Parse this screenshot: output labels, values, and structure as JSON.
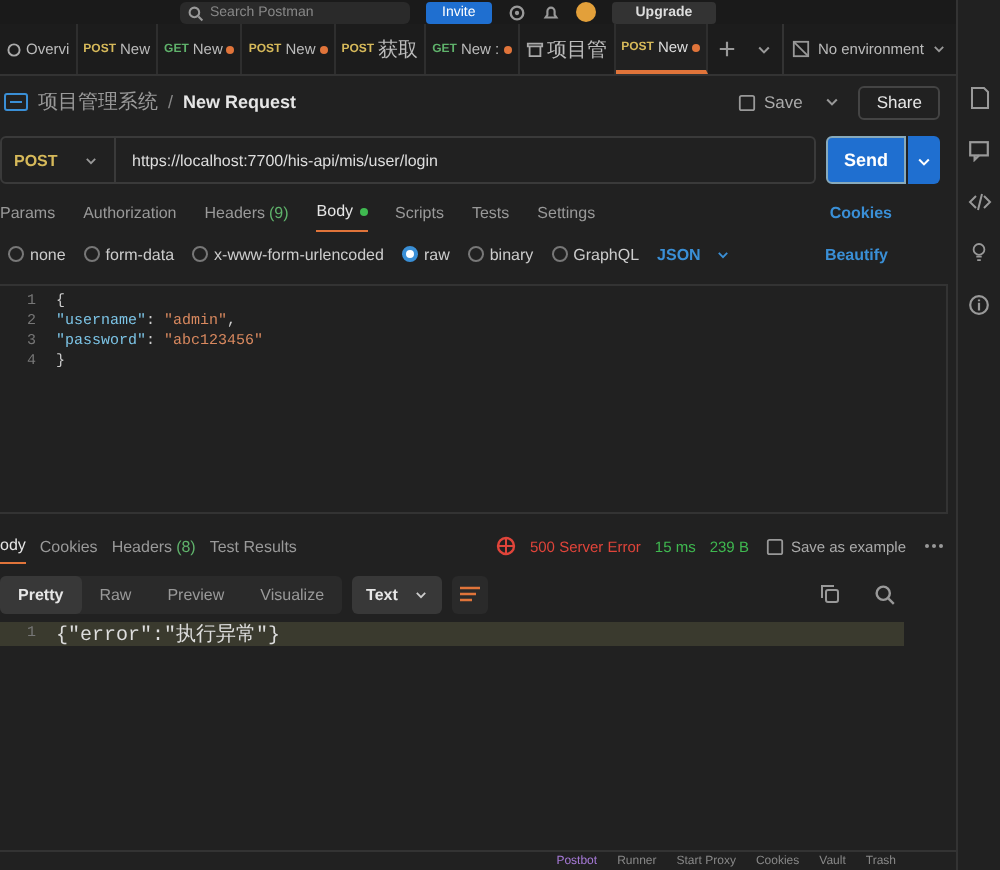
{
  "top_bar": {
    "search": {
      "placeholder": "Search Postman"
    },
    "invite": "Invite",
    "upgrade": "Upgrade"
  },
  "tabs": [
    {
      "kind": "overview",
      "label": "Overvi",
      "unsaved": false,
      "selected": false
    },
    {
      "kind": "request",
      "method": "POST",
      "label": "New",
      "unsaved": false,
      "selected": false
    },
    {
      "kind": "request",
      "method": "GET",
      "label": "New",
      "unsaved": true,
      "selected": false
    },
    {
      "kind": "request",
      "method": "POST",
      "label": "New",
      "unsaved": true,
      "selected": false
    },
    {
      "kind": "request",
      "method": "POST",
      "label": "获取",
      "unsaved": false,
      "selected": false
    },
    {
      "kind": "request",
      "method": "GET",
      "label": "New :",
      "unsaved": true,
      "selected": false
    },
    {
      "kind": "collection",
      "label": "项目管",
      "unsaved": false,
      "selected": false
    },
    {
      "kind": "request",
      "method": "POST",
      "label": "New",
      "unsaved": true,
      "selected": true
    }
  ],
  "environment": "No environment",
  "breadcrumb": {
    "collection": "项目管理系统",
    "separator": "/",
    "request": "New Request"
  },
  "save": "Save",
  "share": "Share",
  "request": {
    "method": "POST",
    "url": "https://localhost:7700/his-api/mis/user/login",
    "send": "Send"
  },
  "request_tabs": [
    {
      "label": "Params",
      "dot": false,
      "selected": false
    },
    {
      "label": "Authorization",
      "dot": false,
      "selected": false
    },
    {
      "label": "Headers",
      "count": "(9)",
      "dot": false,
      "selected": false
    },
    {
      "label": "Body",
      "dot": true,
      "selected": true
    },
    {
      "label": "Scripts",
      "dot": false,
      "selected": false
    },
    {
      "label": "Tests",
      "dot": false,
      "selected": false
    },
    {
      "label": "Settings",
      "dot": false,
      "selected": false
    }
  ],
  "cookies_link": "Cookies",
  "body_types": [
    {
      "label": "none",
      "selected": false
    },
    {
      "label": "form-data",
      "selected": false
    },
    {
      "label": "x-www-form-urlencoded",
      "selected": false
    },
    {
      "label": "raw",
      "selected": true
    },
    {
      "label": "binary",
      "selected": false
    },
    {
      "label": "GraphQL",
      "selected": false
    }
  ],
  "body_format": "JSON",
  "beautify": "Beautify",
  "editor_lines": [
    {
      "number": "1",
      "tokens": [
        {
          "kind": "punct",
          "text": "{"
        }
      ]
    },
    {
      "number": "2",
      "tokens": [
        {
          "kind": "key",
          "text": "\"username\""
        },
        {
          "kind": "punct",
          "text": ": "
        },
        {
          "kind": "str",
          "text": "\"admin\""
        },
        {
          "kind": "punct",
          "text": ","
        }
      ]
    },
    {
      "number": "3",
      "tokens": [
        {
          "kind": "key",
          "text": "\"password\""
        },
        {
          "kind": "punct",
          "text": ": "
        },
        {
          "kind": "str",
          "text": "\"abc123456\""
        }
      ]
    },
    {
      "number": "4",
      "tokens": [
        {
          "kind": "punct",
          "text": "}"
        }
      ]
    }
  ],
  "response_tabs": [
    {
      "label": "ody",
      "selected": true
    },
    {
      "label": "Cookies",
      "selected": false
    },
    {
      "label": "Headers",
      "count": "(8)",
      "selected": false
    },
    {
      "label": "Test Results",
      "selected": false
    }
  ],
  "response_status": {
    "status": "500 Server Error",
    "time": "15 ms",
    "size": "239 B",
    "save_example": "Save as example"
  },
  "view_modes": [
    {
      "label": "Pretty",
      "selected": true
    },
    {
      "label": "Raw",
      "selected": false
    },
    {
      "label": "Preview",
      "selected": false
    },
    {
      "label": "Visualize",
      "selected": false
    }
  ],
  "response_format": "Text",
  "response_lines": [
    {
      "number": "1",
      "text": "{\"error\":\"执行异常\"}",
      "highlighted": true
    }
  ],
  "status_bar": [
    "Postbot",
    "Runner",
    "Start Proxy",
    "Cookies",
    "Vault",
    "Trash"
  ]
}
